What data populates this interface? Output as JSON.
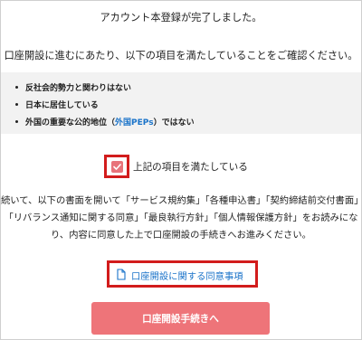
{
  "header": {
    "title": "アカウント本登録が完了しました。",
    "instruction": "口座開設に進むにあたり、以下の項目を満たしていることをご確認ください。"
  },
  "requirements": {
    "items": [
      {
        "text": "反社会的勢力と関わりはない"
      },
      {
        "text": "日本に居住している"
      },
      {
        "prefix": "外国の重要な公的地位（",
        "link": "外国PEPs",
        "suffix": "）ではない"
      }
    ]
  },
  "confirm": {
    "label": "上記の項目を満たしている",
    "checked": true,
    "checkbox_color": "#e8737a",
    "highlight_color": "#d21c1c"
  },
  "documents": {
    "lines": [
      "続いて、以下の書面を開いて「サービス規約集」「各種申込書」「契約締結前交付書面」",
      "「リバランス通知に関する同意」「最良執行方針」「個人情報保護方針」をお読みにな",
      "り、内容に同意した上で口座開設の手続きへお進みください。"
    ],
    "consent_link": "口座開設に関する同意事項",
    "link_color": "#1a73c9"
  },
  "cta": {
    "label": "口座開設手続きへ",
    "color": "#ee7479"
  }
}
